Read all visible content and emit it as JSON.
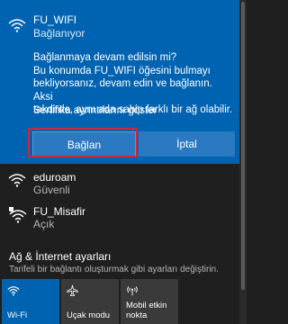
{
  "active_network": {
    "ssid": "FU_WIFI",
    "status": "Bağlanıyor",
    "prompt_lines": [
      "Bağlanmaya devam edilsin mi?",
      "Bu konumda FU_WIFI öğesini bulmayı",
      "bekliyorsanız, devam edin ve bağlanın. Aksi",
      "takdirde, aynı ada sahip farklı bir ağ olabilir."
    ],
    "cert_link": "Sertifika ayrıntılarını göster",
    "connect_label": "Bağlan",
    "cancel_label": "İptal"
  },
  "networks": [
    {
      "name": "eduroam",
      "status": "Güvenli",
      "icon": "wifi-icon"
    },
    {
      "name": "FU_Misafir",
      "status": "Açık",
      "icon": "wifi-shield-icon"
    }
  ],
  "settings": {
    "title": "Ağ & İnternet ayarları",
    "description": "Tarifeli bir bağlantı oluşturmak gibi ayarları değiştirin."
  },
  "tiles": [
    {
      "label": "Wi-Fi",
      "icon": "wifi-icon",
      "active": true
    },
    {
      "label": "Uçak modu",
      "icon": "airplane-icon",
      "active": false
    },
    {
      "label": "Mobil etkin nokta",
      "label_lines": [
        "Mobil etkin",
        "nokta"
      ],
      "icon": "hotspot-icon",
      "active": false
    }
  ],
  "colors": {
    "accent": "#0063b1",
    "button": "#2b79c0",
    "highlight": "#d1263a",
    "background": "#1f1f1f"
  }
}
